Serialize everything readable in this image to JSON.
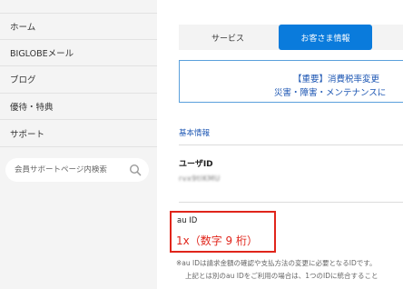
{
  "sidebar": {
    "items": [
      {
        "label": "ホーム"
      },
      {
        "label": "BIGLOBEメール"
      },
      {
        "label": "ブログ"
      },
      {
        "label": "優待・特典"
      },
      {
        "label": "サポート"
      }
    ],
    "search": {
      "placeholder": "会員サポートページ内検索",
      "icon": "search-icon"
    }
  },
  "tabs": [
    {
      "label": "サービス"
    },
    {
      "label": "お客さま情報"
    }
  ],
  "notice": {
    "line1": "【重要】消費税率変更",
    "line2": "災害・障害・メンテナンスに"
  },
  "section": {
    "title": "基本情報"
  },
  "user_id": {
    "label": "ユーザID",
    "value": "rvx9tlKMU"
  },
  "au_id": {
    "label": "au ID",
    "value": "1x（数字 9 桁）"
  },
  "note": {
    "line1": "※au IDは請求金額の確認や支払方法の変更に必要となるIDです。",
    "line2": "上記とは別のau IDをご利用の場合は、1つのIDに統合すること"
  },
  "colors": {
    "accent": "#0a7bdc",
    "highlight": "#e0251b",
    "link": "#1c56b3"
  }
}
